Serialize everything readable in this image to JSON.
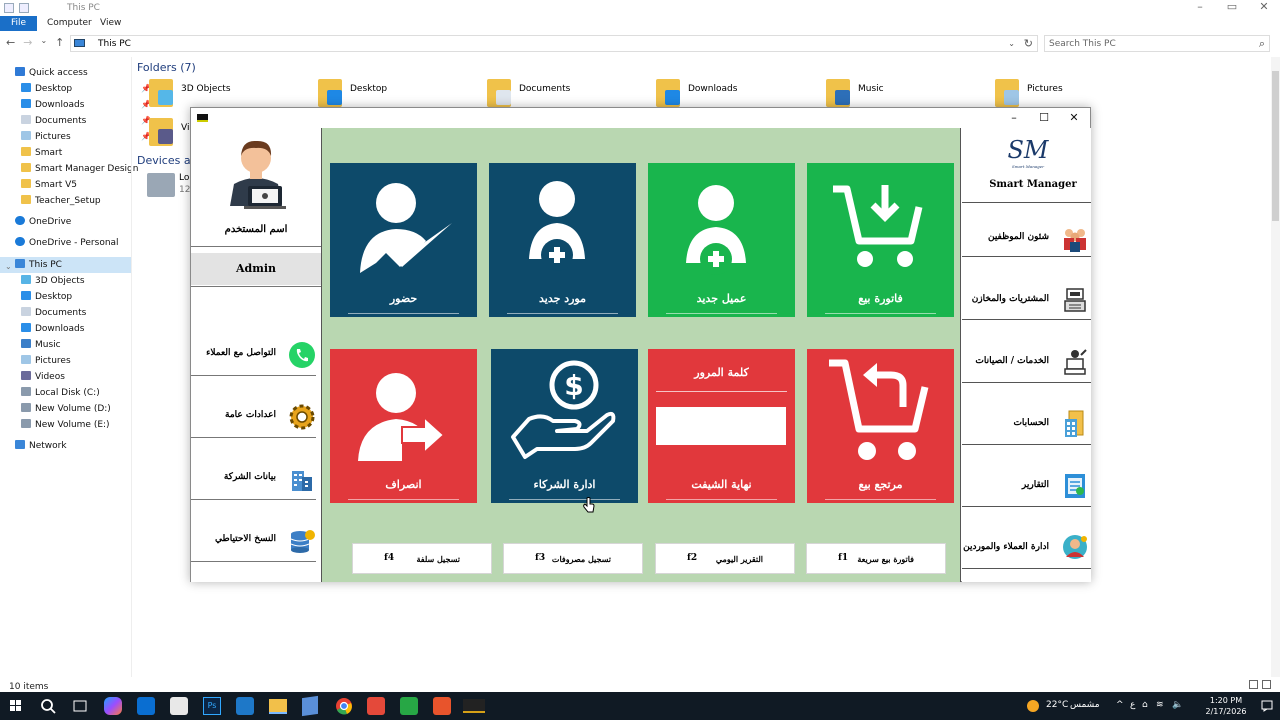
{
  "explorer": {
    "title": "This PC",
    "menu": {
      "file": "File",
      "computer": "Computer",
      "view": "View"
    },
    "address": "This PC",
    "search_placeholder": "Search This PC",
    "status": "10 items",
    "folders_header": "Folders (7)",
    "devices_header": "Devices a",
    "device_label": "Lo",
    "device_sub": "12",
    "folders": [
      {
        "label": "3D Objects"
      },
      {
        "label": "Desktop"
      },
      {
        "label": "Documents"
      },
      {
        "label": "Downloads"
      },
      {
        "label": "Music"
      },
      {
        "label": "Pictures"
      },
      {
        "label": "Vi"
      }
    ],
    "nav": {
      "quick_access": "Quick access",
      "quick_items": [
        "Desktop",
        "Downloads",
        "Documents",
        "Pictures",
        "Smart",
        "Smart Manager Design",
        "Smart V5",
        "Teacher_Setup"
      ],
      "onedrive": "OneDrive",
      "onedrive_personal": "OneDrive - Personal",
      "this_pc": "This PC",
      "pc_items": [
        "3D Objects",
        "Desktop",
        "Documents",
        "Downloads",
        "Music",
        "Pictures",
        "Videos",
        "Local Disk (C:)",
        "New Volume (D:)",
        "New Volume (E:)"
      ],
      "network": "Network"
    }
  },
  "app": {
    "user_label": "اسم المستخدم",
    "user_name": "Admin",
    "left_menu": [
      {
        "label": "التواصل مع العملاء",
        "icon": "whatsapp-icon"
      },
      {
        "label": "اعدادات عامة",
        "icon": "gear-icon"
      },
      {
        "label": "بيانات الشركة",
        "icon": "building-icon"
      },
      {
        "label": "النسخ الاحتياطي",
        "icon": "database-icon"
      }
    ],
    "tiles": [
      {
        "label": "حضور",
        "icon": "attendance-icon",
        "color": "#0d4a6a"
      },
      {
        "label": "مورد جديد",
        "icon": "add-supplier-icon",
        "color": "#0d4a6a"
      },
      {
        "label": "عميل جديد",
        "icon": "add-customer-icon",
        "color": "#19b54d"
      },
      {
        "label": "فاتورة بيع",
        "icon": "cart-download-icon",
        "color": "#19b54d"
      },
      {
        "label": "انصراف",
        "icon": "checkout-icon",
        "color": "#e1383c"
      },
      {
        "label": "ادارة الشركاء",
        "icon": "money-hand-icon",
        "color": "#0d4a6a"
      },
      {
        "label": "نهاية الشيفت",
        "top_label": "كلمة المرور",
        "color": "#e1383c"
      },
      {
        "label": "مرتجع بيع",
        "icon": "cart-return-icon",
        "color": "#e1383c"
      }
    ],
    "shortcuts": [
      {
        "key": "f4",
        "label": "تسجيل سلفة"
      },
      {
        "key": "f3",
        "label": "تسجيل مصروفات"
      },
      {
        "key": "f2",
        "label": "التقرير اليومي"
      },
      {
        "key": "f1",
        "label": "فاتورة بيع سريعة"
      }
    ],
    "brand": "Smart Manager",
    "logo_text": "Smart Manager",
    "right_menu": [
      {
        "label": "شئون الموظفين",
        "icon": "employees-icon"
      },
      {
        "label": "المشتريات والمخازن",
        "icon": "cashier-icon"
      },
      {
        "label": "الخدمات / الصيانات",
        "icon": "maintenance-icon"
      },
      {
        "label": "الحسابات",
        "icon": "accounts-icon"
      },
      {
        "label": "التقارير",
        "icon": "reports-icon"
      },
      {
        "label": "ادارة العملاء والموردين",
        "icon": "clients-icon"
      }
    ]
  },
  "taskbar": {
    "weather": "22°C",
    "weather_desc": "مشمس",
    "lang": "ع",
    "time": "1:20 PM",
    "date": "2/17/2026"
  }
}
